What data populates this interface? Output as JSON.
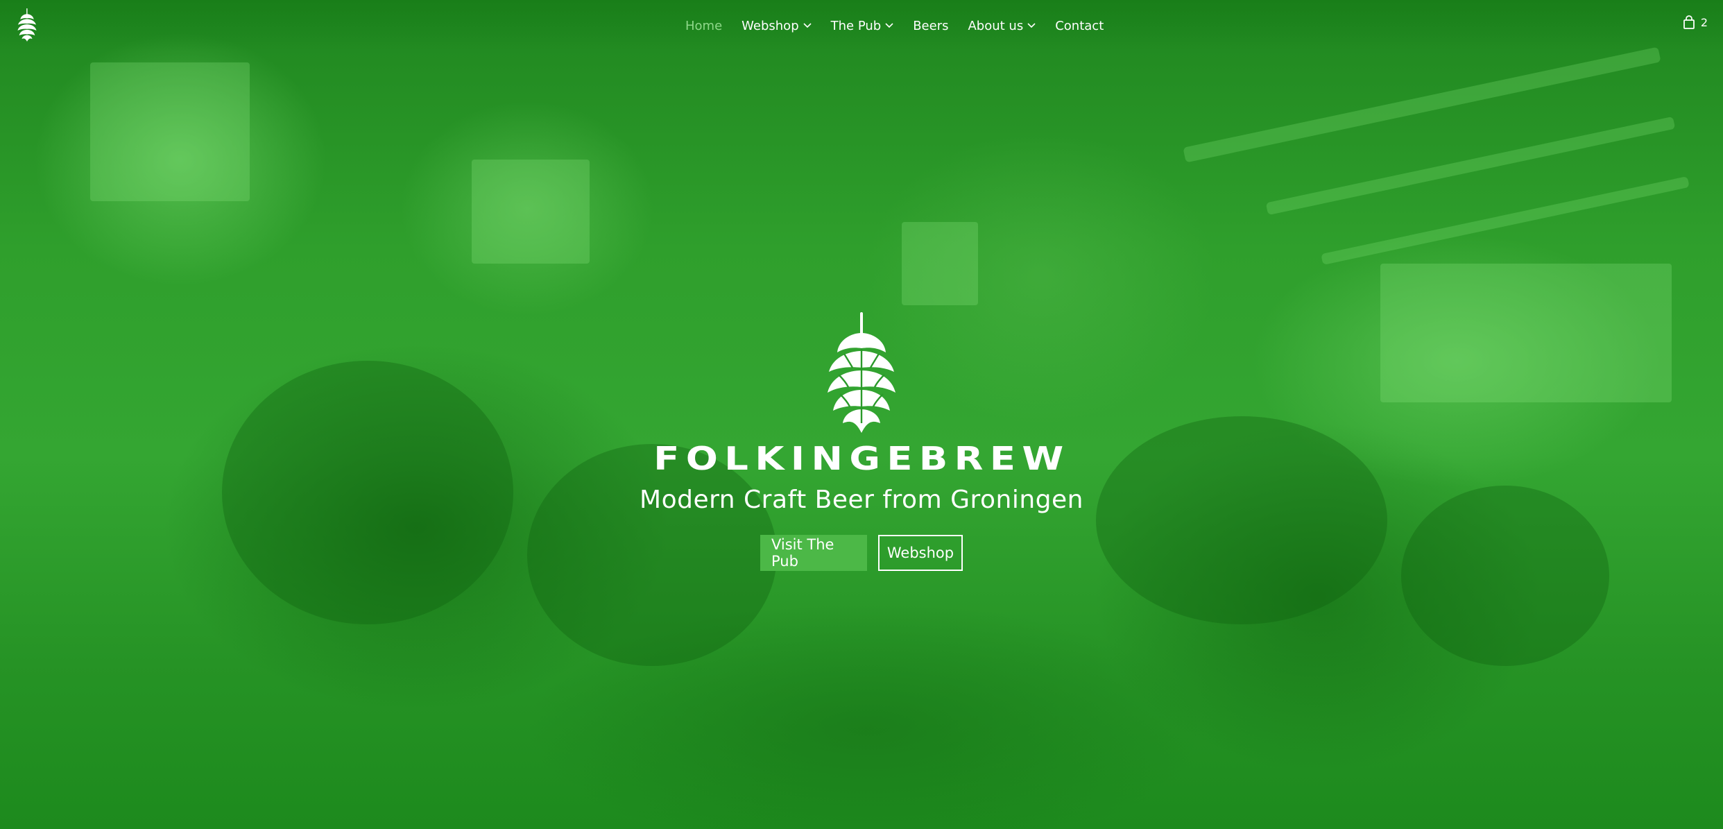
{
  "colors": {
    "overlay": "#2a9a2a",
    "accent": "#4cb847",
    "nav_active": "#8fd88a",
    "text": "#ffffff"
  },
  "header": {
    "logo_icon": "hop-cone-icon",
    "nav": [
      {
        "label": "Home",
        "active": true,
        "dropdown": false
      },
      {
        "label": "Webshop",
        "active": false,
        "dropdown": true
      },
      {
        "label": "The Pub",
        "active": false,
        "dropdown": true
      },
      {
        "label": "Beers",
        "active": false,
        "dropdown": false
      },
      {
        "label": "About us",
        "active": false,
        "dropdown": true
      },
      {
        "label": "Contact",
        "active": false,
        "dropdown": false
      }
    ],
    "cart": {
      "icon": "shopping-bag-icon",
      "count": "2"
    }
  },
  "hero": {
    "brand": "FOLKINGEBREW",
    "tagline": "Modern Craft Beer from Groningen",
    "primary_button": "Visit The Pub",
    "secondary_button": "Webshop"
  }
}
